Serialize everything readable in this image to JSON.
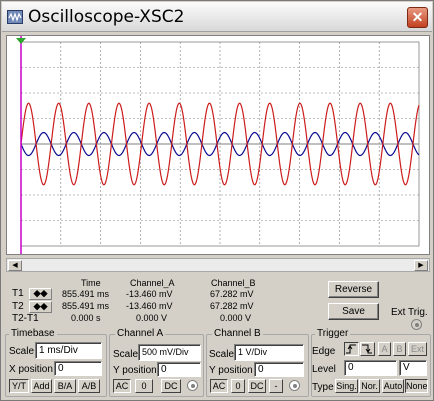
{
  "window": {
    "title": "Oscilloscope-XSC2",
    "close_glyph": "✕"
  },
  "icons": {
    "app": "oscilloscope-icon",
    "close": "close-icon",
    "scroll_left": "left-arrow-icon",
    "scroll_right": "right-arrow-icon",
    "cursor_marker": "trigger-marker-icon"
  },
  "colors": {
    "channel_a": "#0b0b8f",
    "channel_b": "#cc1c1c",
    "cursor": "#c800c8",
    "trigger_marker": "#2ca52c",
    "grid": "#808080"
  },
  "display": {
    "x_divisions": 10,
    "y_divisions": 8,
    "grid": "dashed"
  },
  "chart_data": {
    "type": "line",
    "title": "",
    "xlabel": "",
    "ylabel": "",
    "xlim": [
      0,
      10
    ],
    "ylim": [
      -4,
      4
    ],
    "series": [
      {
        "name": "Channel_A",
        "amplitude_div": 0.45,
        "cycles": 13.2,
        "phase_deg": 180
      },
      {
        "name": "Channel_B",
        "amplitude_div": 1.6,
        "cycles": 13.2,
        "phase_deg": 0
      }
    ]
  },
  "readout": {
    "headers": [
      "Time",
      "Channel_A",
      "Channel_B"
    ],
    "rows": [
      {
        "label": "T1",
        "time": "855.491 ms",
        "a": "-13.460 mV",
        "b": "67.282 mV"
      },
      {
        "label": "T2",
        "time": "855.491 ms",
        "a": "-13.460 mV",
        "b": "67.282 mV"
      },
      {
        "label": "T2-T1",
        "time": "0.000 s",
        "a": "0.000 V",
        "b": "0.000 V"
      }
    ],
    "arrow_glyph": "◆◆"
  },
  "buttons": {
    "reverse": "Reverse",
    "save": "Save",
    "ext_trig": "Ext Trig."
  },
  "timebase": {
    "title": "Timebase",
    "scale_label": "Scale",
    "scale_value": "1 ms/Div",
    "xpos_label": "X position",
    "xpos_value": "0",
    "modes": [
      "Y/T",
      "Add",
      "B/A",
      "A/B"
    ]
  },
  "channel_a": {
    "title": "Channel A",
    "scale_label": "Scale",
    "scale_value": "500 mV/Div",
    "ypos_label": "Y position",
    "ypos_value": "0",
    "coupling": [
      "AC",
      "0",
      "DC"
    ]
  },
  "channel_b": {
    "title": "Channel B",
    "scale_label": "Scale",
    "scale_value": "1  V/Div",
    "ypos_label": "Y position",
    "ypos_value": "0",
    "coupling": [
      "AC",
      "0",
      "DC",
      "-"
    ]
  },
  "trigger": {
    "title": "Trigger",
    "edge_label": "Edge",
    "edge_buttons": [
      "A",
      "B",
      "Ext"
    ],
    "level_label": "Level",
    "level_value": "0",
    "level_unit": "V",
    "type_label": "Type",
    "types": [
      "Sing.",
      "Nor.",
      "Auto",
      "None"
    ]
  }
}
